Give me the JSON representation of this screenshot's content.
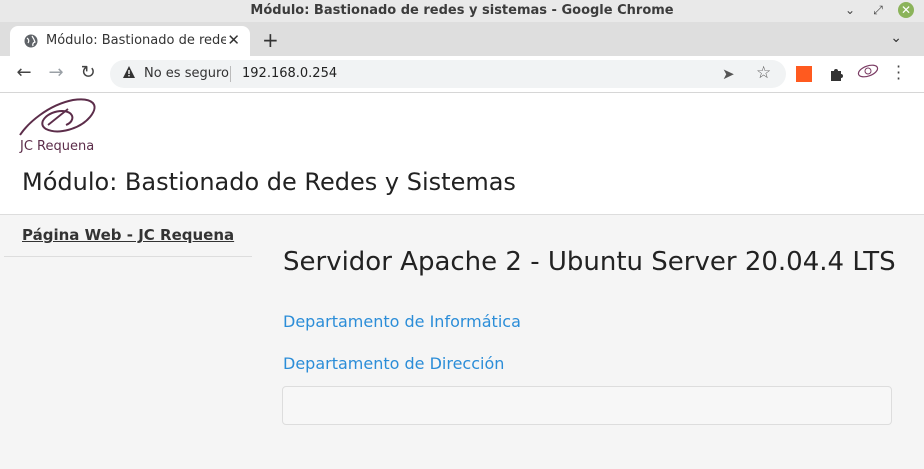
{
  "window": {
    "title": "Módulo: Bastionado de redes y sistemas - Google Chrome"
  },
  "tab": {
    "title": "Módulo: Bastionado de redes y sistemas",
    "close": "✕"
  },
  "toolbar": {
    "security_label": "No es seguro",
    "url": "192.168.0.254"
  },
  "site": {
    "logo_text": "JC Requena",
    "title": "Módulo: Bastionado de Redes y Sistemas"
  },
  "sidebar": {
    "link": "Página Web - JC Requena"
  },
  "main": {
    "title": "Servidor Apache 2 - Ubuntu Server 20.04.4 LTS",
    "links": [
      "Departamento de Informática",
      "Departamento de Dirección"
    ]
  },
  "colors": {
    "link": "#2b8dd8",
    "logo": "#5c2d4a"
  },
  "icons": [
    "globe-icon",
    "close-icon",
    "plus-icon",
    "chevron-down-icon",
    "back-icon",
    "forward-icon",
    "reload-icon",
    "warning-icon",
    "send-icon",
    "star-icon",
    "gpx-extension-icon",
    "puzzle-icon",
    "profile-logo-icon",
    "menu-icon"
  ]
}
